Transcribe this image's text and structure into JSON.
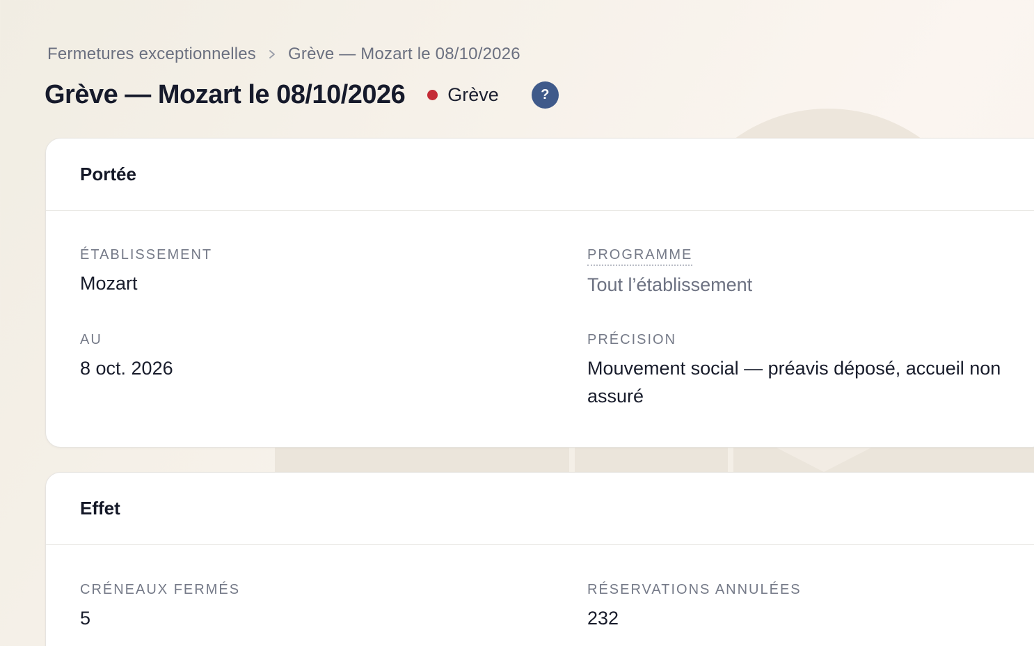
{
  "breadcrumb": {
    "parent": "Fermetures exceptionnelles",
    "current": "Grève — Mozart le 08/10/2026"
  },
  "header": {
    "title": "Grève — Mozart le 08/10/2026",
    "status_label": "Grève",
    "status_color": "#c42b36",
    "help_label": "?"
  },
  "portee": {
    "title": "Portée",
    "etablissement_label": "ÉTABLISSEMENT",
    "etablissement_value": "Mozart",
    "programme_label": "PROGRAMME",
    "programme_value": "Tout l’établissement",
    "au_label": "AU",
    "au_value": "8 oct. 2026",
    "precision_label": "PRÉCISION",
    "precision_value": "Mouvement social — préavis déposé, accueil non assuré"
  },
  "effet": {
    "title": "Effet",
    "creneaux_label": "CRÉNEAUX FERMÉS",
    "creneaux_value": "5",
    "reservations_label": "RÉSERVATIONS ANNULÉES",
    "reservations_value": "232"
  },
  "icons": {
    "breadcrumb_separator": "chevron-right-icon",
    "help": "question-mark-icon"
  }
}
